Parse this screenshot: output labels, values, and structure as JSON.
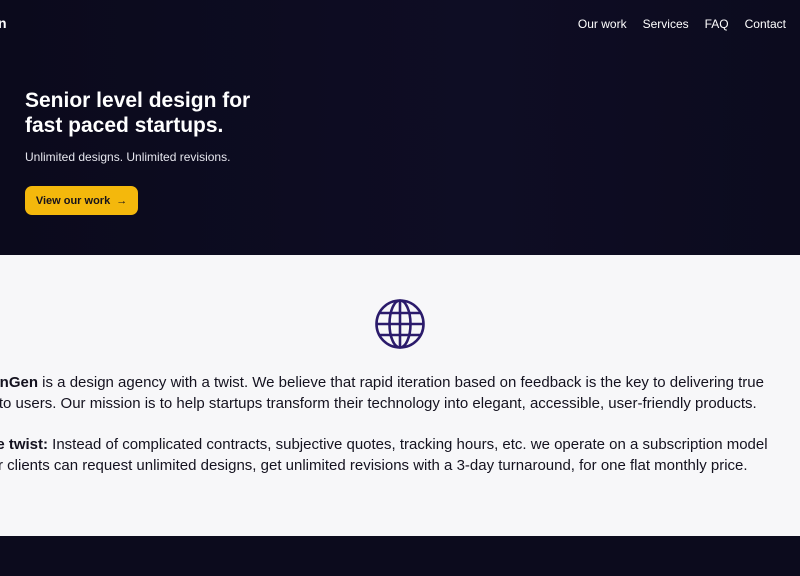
{
  "header": {
    "brand": "n",
    "nav": [
      "Our work",
      "Services",
      "FAQ",
      "Contact"
    ]
  },
  "hero": {
    "title": "Senior level design for fast paced startups.",
    "subtitle": "Unlimited designs. Unlimited revisions.",
    "cta_label": "View our work",
    "cta_icon": "arrow-right-icon",
    "cta_arrow": "→"
  },
  "about": {
    "icon": "globe-icon",
    "p1_bold": "signGen",
    "p1_line1": " is a design agency with a twist. We believe that rapid iteration based on feedback is the key to delivering true",
    "p1_line2": "ue to users. Our mission is to help startups transform their technology into elegant, accessible, user-friendly products.",
    "p2_bold": "The twist:",
    "p2_line1": " Instead of complicated contracts, subjective quotes, tracking hours, etc. we operate on a subscription model",
    "p2_line2": "Our clients can request unlimited designs, get unlimited revisions with a 3-day turnaround, for one flat monthly price."
  },
  "colors": {
    "dark_bg": "#0c0b1d",
    "accent": "#f4b80c",
    "light_bg": "#f7f7f9",
    "globe": "#2b1b6b"
  }
}
